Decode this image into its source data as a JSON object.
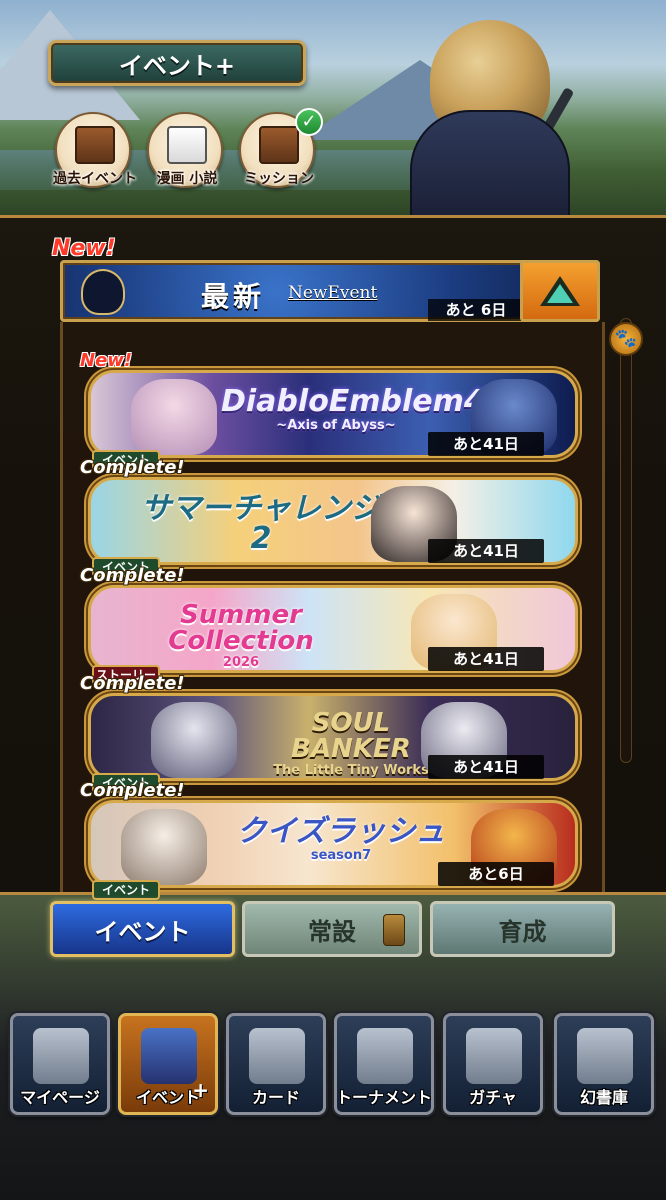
{
  "header": {
    "title": "イベント+",
    "shortcuts": [
      {
        "label": "過去イベント",
        "icon": "book-icon"
      },
      {
        "label": "漫画 小説",
        "icon": "manga-icon"
      },
      {
        "label": "ミッション",
        "icon": "mission-icon",
        "badge": "✓"
      }
    ]
  },
  "latest": {
    "new_label": "New!",
    "title": "最新",
    "subtitle": "NewEvent",
    "remaining": "あと 6日"
  },
  "events": [
    {
      "status": "New!",
      "logo": "DiabloEmblem4",
      "logo_sub": "~Axis of Abyss~",
      "type": "イベント",
      "remaining": "あと41日"
    },
    {
      "status": "Complete!",
      "logo": "サマーチャレンジ2",
      "logo_sub": "",
      "type": "イベント",
      "remaining": "あと41日"
    },
    {
      "status": "Complete!",
      "logo": "Summer Collection",
      "logo_sub": "2026",
      "type": "ストーリー",
      "remaining": "あと41日"
    },
    {
      "status": "Complete!",
      "logo": "SOUL BANKER",
      "logo_sub": "The Little Tiny Works",
      "type": "イベント",
      "remaining": "あと41日"
    },
    {
      "status": "Complete!",
      "logo": "クイズラッシュ",
      "logo_sub": "season7",
      "type": "イベント",
      "remaining": "あと6日"
    }
  ],
  "tabs": [
    {
      "label": "イベント",
      "active": true
    },
    {
      "label": "常設",
      "active": false
    },
    {
      "label": "育成",
      "active": false
    }
  ],
  "nav": [
    {
      "label": "マイページ",
      "icon": "home-icon"
    },
    {
      "label": "イベント",
      "icon": "event-cat-icon",
      "plus": "+",
      "active": true
    },
    {
      "label": "カード",
      "icon": "cards-icon"
    },
    {
      "label": "トーナメント",
      "icon": "trophy-icon"
    },
    {
      "label": "ガチャ",
      "icon": "gacha-icon"
    },
    {
      "label": "幻書庫",
      "icon": "library-icon"
    }
  ]
}
